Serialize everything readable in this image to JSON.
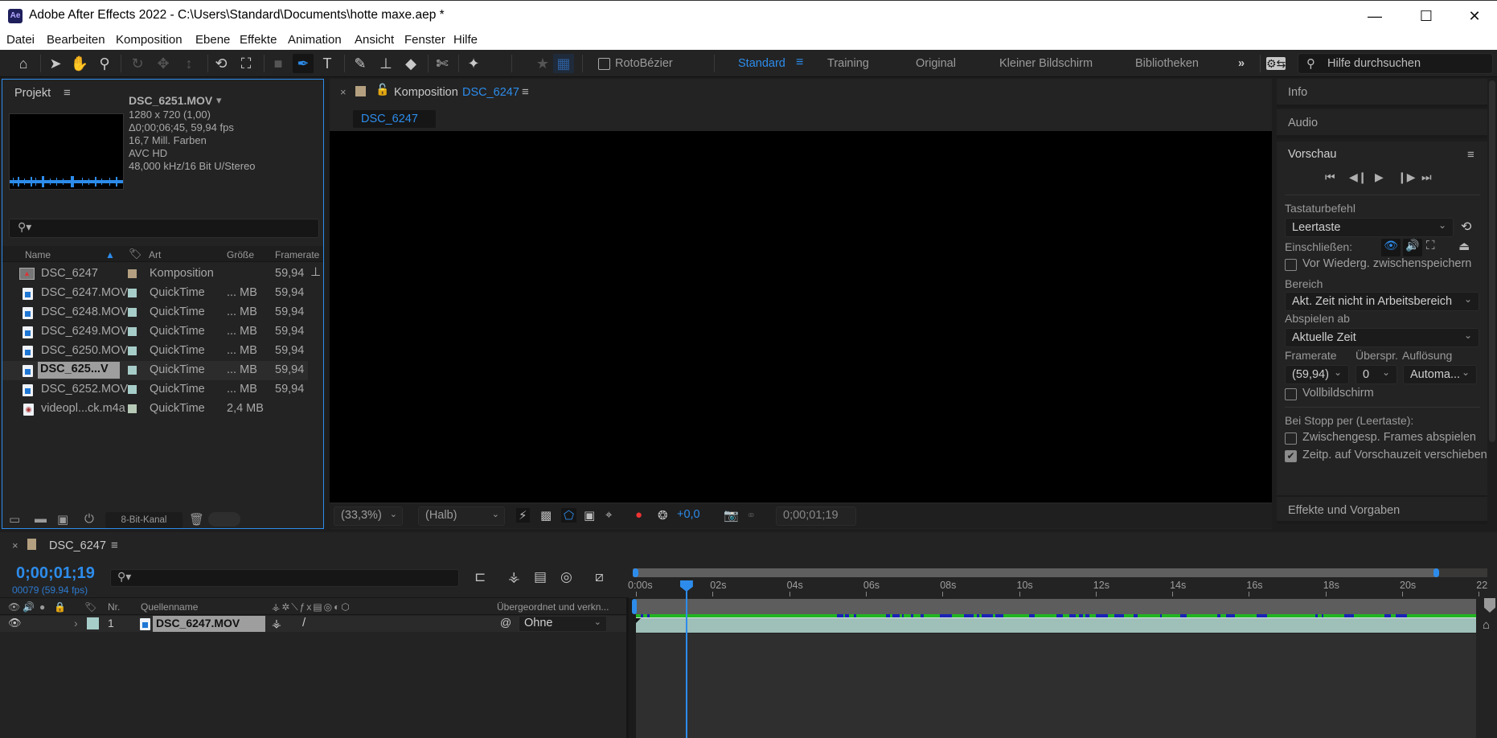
{
  "window": {
    "app_icon": "Ae",
    "title": "Adobe After Effects 2022 - C:\\Users\\Standard\\Documents\\hotte maxe.aep *",
    "minimize": "—",
    "maximize": "☐",
    "close": "✕"
  },
  "menu": [
    "Datei",
    "Bearbeiten",
    "Komposition",
    "Ebene",
    "Effekte",
    "Animation",
    "Ansicht",
    "Fenster",
    "Hilfe"
  ],
  "toolbar": {
    "tools": [
      {
        "name": "home-icon",
        "glyph": "⌂"
      },
      {
        "name": "selection-tool-icon",
        "glyph": "➤"
      },
      {
        "name": "hand-tool-icon",
        "glyph": "✋"
      },
      {
        "name": "zoom-tool-icon",
        "glyph": "⚲"
      },
      {
        "name": "orbit-camera-icon",
        "glyph": "↻"
      },
      {
        "name": "pan-camera-icon",
        "glyph": "✥"
      },
      {
        "name": "dolly-camera-icon",
        "glyph": "↕"
      },
      {
        "name": "rotation-tool-icon",
        "glyph": "⟲"
      },
      {
        "name": "anchor-point-tool-icon",
        "glyph": "⛶"
      },
      {
        "name": "rectangle-tool-icon",
        "glyph": "■"
      },
      {
        "name": "pen-tool-icon",
        "glyph": "✒"
      },
      {
        "name": "type-tool-icon",
        "glyph": "T"
      },
      {
        "name": "brush-tool-icon",
        "glyph": "✎"
      },
      {
        "name": "clone-stamp-tool-icon",
        "glyph": "⊥"
      },
      {
        "name": "eraser-tool-icon",
        "glyph": "◆"
      },
      {
        "name": "roto-brush-tool-icon",
        "glyph": "✄"
      },
      {
        "name": "puppet-pin-tool-icon",
        "glyph": "✦"
      }
    ],
    "roto_bezier_label": "RotoBézier",
    "roto_bezier_checked": false,
    "workspaces": [
      "Standard",
      "Training",
      "Original",
      "Kleiner Bildschirm",
      "Bibliotheken"
    ],
    "active_workspace": "Standard",
    "more": "»",
    "help_search_placeholder": "Hilfe durchsuchen"
  },
  "project": {
    "tab": "Projekt",
    "preview": {
      "name": "DSC_6251.MOV",
      "lines": [
        "1280 x 720 (1,00)",
        "Δ0;00;06;45, 59,94 fps",
        "16,7 Mill. Farben",
        "AVC HD",
        "48,000 kHz/16 Bit U/Stereo"
      ]
    },
    "search_value": "",
    "columns": {
      "name": "Name",
      "type": "Art",
      "size": "Größe",
      "framerate": "Framerate"
    },
    "items": [
      {
        "name": "DSC_6247",
        "icon": "composition",
        "label_color": "#b4a080",
        "type": "Komposition",
        "size": "",
        "framerate": "59,94"
      },
      {
        "name": "DSC_6247.MOV",
        "icon": "video",
        "label_color": "#a7cdc9",
        "type": "QuickTime",
        "size": "... MB",
        "framerate": "59,94"
      },
      {
        "name": "DSC_6248.MOV",
        "icon": "video",
        "label_color": "#a7cdc9",
        "type": "QuickTime",
        "size": "... MB",
        "framerate": "59,94"
      },
      {
        "name": "DSC_6249.MOV",
        "icon": "video",
        "label_color": "#a7cdc9",
        "type": "QuickTime",
        "size": "... MB",
        "framerate": "59,94"
      },
      {
        "name": "DSC_6250.MOV",
        "icon": "video",
        "label_color": "#a7cdc9",
        "type": "QuickTime",
        "size": "... MB",
        "framerate": "59,94"
      },
      {
        "name": "DSC_625...V",
        "icon": "video",
        "label_color": "#a7cdc9",
        "type": "QuickTime",
        "size": "... MB",
        "framerate": "59,94",
        "selected": true
      },
      {
        "name": "DSC_6252.MOV",
        "icon": "video",
        "label_color": "#a7cdc9",
        "type": "QuickTime",
        "size": "... MB",
        "framerate": "59,94"
      },
      {
        "name": "videopl...ck.m4a",
        "icon": "audio",
        "label_color": "#b6c9b6",
        "type": "QuickTime",
        "size": "2,4 MB",
        "framerate": ""
      }
    ],
    "bit_depth": "8-Bit-Kanal"
  },
  "composition": {
    "tab_prefix": "Komposition",
    "tab_name": "DSC_6247",
    "breadcrumb": "DSC_6247",
    "zoom": "(33,3%)",
    "resolution": "(Halb)",
    "exposure": "+0,0",
    "current_time": "0;00;01;19"
  },
  "right_panel": {
    "info_tab": "Info",
    "audio_tab": "Audio",
    "preview_tab": "Vorschau",
    "shortcut_label": "Tastaturbefehl",
    "shortcut_value": "Leertaste",
    "include_label": "Einschließen:",
    "cache_before_label": "Vor Wiederg. zwischenspeichern",
    "cache_before_checked": false,
    "range_label": "Bereich",
    "range_value": "Akt. Zeit nicht in Arbeitsbereich",
    "play_from_label": "Abspielen ab",
    "play_from_value": "Aktuelle Zeit",
    "framerate_label": "Framerate",
    "skip_label": "Überspr.",
    "resolution_label": "Auflösung",
    "framerate_value": "(59,94)",
    "skip_value": "0",
    "resolution_value": "Automa...",
    "fullscreen_label": "Vollbildschirm",
    "fullscreen_checked": false,
    "on_stop_label": "Bei Stopp per (Leertaste):",
    "play_cached_label": "Zwischengesp. Frames abspielen",
    "play_cached_checked": false,
    "move_time_label": "Zeitp. auf Vorschauzeit verschieben",
    "move_time_checked": true,
    "effects_tab": "Effekte und Vorgaben"
  },
  "timeline": {
    "tab": "DSC_6247",
    "timecode": "0;00;01;19",
    "frames": "00079 (59.94 fps)",
    "search_value": "",
    "columns": {
      "nr": "Nr.",
      "source": "Quellenname",
      "parent": "Übergeordnet und verkn..."
    },
    "layers": [
      {
        "nr": "1",
        "name": "DSC_6247.MOV",
        "label_color": "#a7cdc9",
        "parent": "Ohne"
      }
    ],
    "ruler_labels": [
      "0:00s",
      "02s",
      "04s",
      "06s",
      "08s",
      "10s",
      "12s",
      "14s",
      "16s",
      "18s",
      "20s",
      "22"
    ],
    "playhead_seconds": 1.32,
    "colors": {
      "accent": "#2d8ceb",
      "cache_green": "#22b522",
      "cache_blue": "#1b22b5",
      "layer_bar": "#9fbfb9"
    }
  }
}
